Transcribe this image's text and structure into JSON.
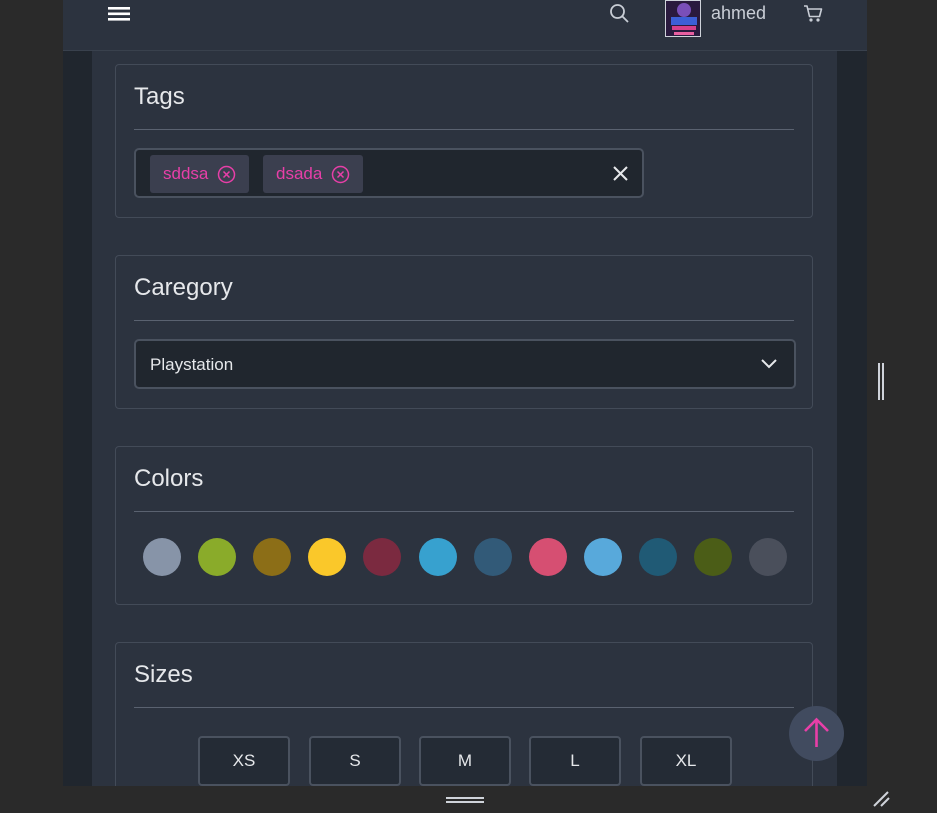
{
  "header": {
    "username": "ahmed"
  },
  "icons": {
    "menu": "hamburger-menu-icon",
    "search": "magnifier-search-icon",
    "cart": "shopping-cart-icon",
    "scroll_top": "arrow-up-icon"
  },
  "tags_section": {
    "title": "Tags",
    "chips": [
      {
        "label": "sddsa"
      },
      {
        "label": "dsada"
      }
    ]
  },
  "category_section": {
    "title": "Caregory",
    "selected": "Playstation"
  },
  "colors_section": {
    "title": "Colors",
    "swatches": [
      "#8794a8",
      "#8aab2a",
      "#8c6e17",
      "#fac82a",
      "#7b2a40",
      "#37a1cf",
      "#325a78",
      "#d64f72",
      "#58a9db",
      "#205a75",
      "#4b5d17",
      "#4a4f5b"
    ]
  },
  "sizes_section": {
    "title": "Sizes",
    "sizes": [
      "XS",
      "S",
      "M",
      "L",
      "XL"
    ]
  },
  "theme": {
    "accent": "#e83fa8",
    "panel": "#2c333f",
    "background": "#20262e"
  }
}
